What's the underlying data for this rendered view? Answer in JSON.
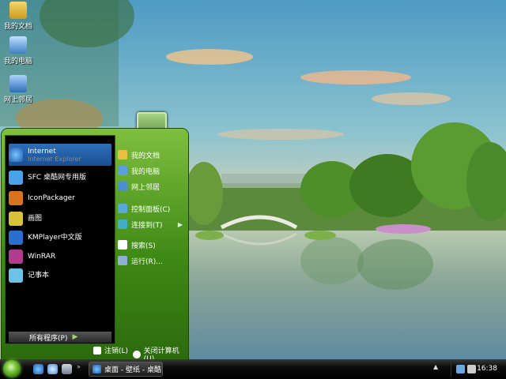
{
  "desktop": {
    "icons": [
      {
        "label": "我的文档",
        "icon": "my-documents-icon"
      },
      {
        "label": "我的电脑",
        "icon": "my-computer-icon"
      },
      {
        "label": "网上邻居",
        "icon": "network-icon"
      }
    ]
  },
  "start_menu": {
    "pinned": [
      {
        "title": "Internet",
        "subtitle": "Internet Explorer",
        "icon": "internet-explorer-icon",
        "color": "#3b8de0"
      },
      {
        "title": "SFC 桌酷网专用版",
        "icon": "sfc-icon",
        "color": "#4aa3e8"
      },
      {
        "title": "IconPackager",
        "icon": "iconpackager-icon",
        "color": "#d9731f"
      },
      {
        "title": "画图",
        "icon": "paint-icon",
        "color": "#d8c23a"
      },
      {
        "title": "KMPlayer中文版",
        "icon": "kmplayer-icon",
        "color": "#2a6fd0"
      },
      {
        "title": "WinRAR",
        "icon": "winrar-icon",
        "color": "#b13b8e"
      },
      {
        "title": "记事本",
        "icon": "notepad-icon",
        "color": "#6cc3e8"
      }
    ],
    "all_programs": "所有程序(P)",
    "places": [
      {
        "label": "我的文档",
        "icon": "folder-icon",
        "color": "#e8c040"
      },
      {
        "label": "我的电脑",
        "icon": "computer-icon",
        "color": "#5aa0e0"
      },
      {
        "label": "网上邻居",
        "icon": "network-icon",
        "color": "#4a90d0"
      },
      {
        "label": "控制面板(C)",
        "icon": "control-panel-icon",
        "color": "#58a8e0"
      },
      {
        "label": "连接到(T)",
        "icon": "connect-icon",
        "color": "#3fb0c8",
        "has_submenu": true
      },
      {
        "label": "搜索(S)",
        "icon": "search-icon",
        "color": "#ffffff"
      },
      {
        "label": "运行(R)...",
        "icon": "run-icon",
        "color": "#8fb0d0"
      }
    ],
    "footer": {
      "logoff": "注销(L)",
      "shutdown": "关闭计算机(U)"
    }
  },
  "taskbar": {
    "task_label": "桌面 - 壁纸 - 桌酷...",
    "clock": "16:38"
  }
}
